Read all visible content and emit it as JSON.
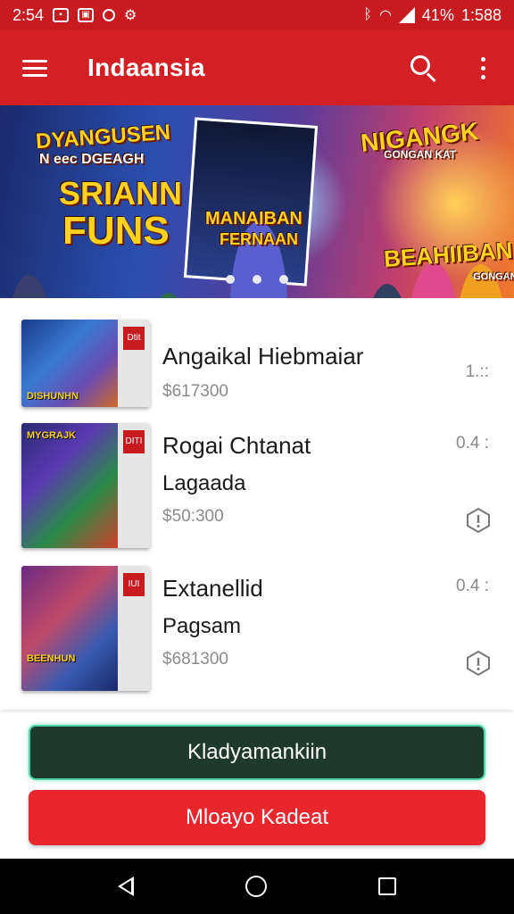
{
  "status_bar": {
    "time": "2:54",
    "battery": "41%",
    "clock_right": "1:588",
    "icons": [
      "message-icon",
      "briefcase-icon",
      "notification-icon",
      "sync-icon",
      "bluetooth-icon",
      "wifi-icon",
      "signal-icon",
      "battery-icon"
    ]
  },
  "appbar": {
    "title": "Indaansia",
    "menu_icon": "hamburger-menu-icon",
    "search_icon": "search-icon",
    "more_icon": "more-vert-icon"
  },
  "banner": {
    "left_line1": "DYANGUSEN",
    "left_line2": "N eec DGEAGH",
    "left_line3": "SRIANN",
    "left_line4": "FUNS",
    "center_line1": "MANAIBAN",
    "center_line2": "FERNAAN",
    "right_line1": "NIGANGK",
    "right_line2": "GONGAN KAT",
    "right_line3": "BEAHIIBAN",
    "right_line4": "GONGAN",
    "page_count": 3
  },
  "list": {
    "items": [
      {
        "title": "Angaikal Hiebmaiar",
        "subtitle": "",
        "price": "$617300",
        "meta": "1.::",
        "thumb_caption": "DISHUNHN",
        "thumb_tag": "Dtit",
        "shield_icon": "shield-alert-icon",
        "has_shield": false
      },
      {
        "title": "Rogai Chtanat",
        "subtitle": "Lagaada",
        "price": "$50:300",
        "meta": "0.4 :",
        "thumb_caption": "MYGRAJK",
        "thumb_tag": "DITI",
        "shield_icon": "shield-alert-icon",
        "has_shield": true
      },
      {
        "title": "Extanellid",
        "subtitle": "Pagsam",
        "price": "$681300",
        "meta": "0.4 :",
        "thumb_caption": "BEENHUN",
        "thumb_tag": "IUI",
        "shield_icon": "shield-alert-icon",
        "has_shield": true
      }
    ]
  },
  "buttons": {
    "primary_label": "Kladyamankiin",
    "danger_label": "Mloayo Kadeat"
  },
  "navbar": {
    "back_icon": "back-icon",
    "home_icon": "home-icon",
    "recent_icon": "recent-apps-icon"
  },
  "colors": {
    "appbar": "#d32024",
    "status_bar": "#c81b1f",
    "primary_button": "#1d3a2c",
    "primary_button_border": "#4ed3a8",
    "danger_button": "#e8262b"
  }
}
